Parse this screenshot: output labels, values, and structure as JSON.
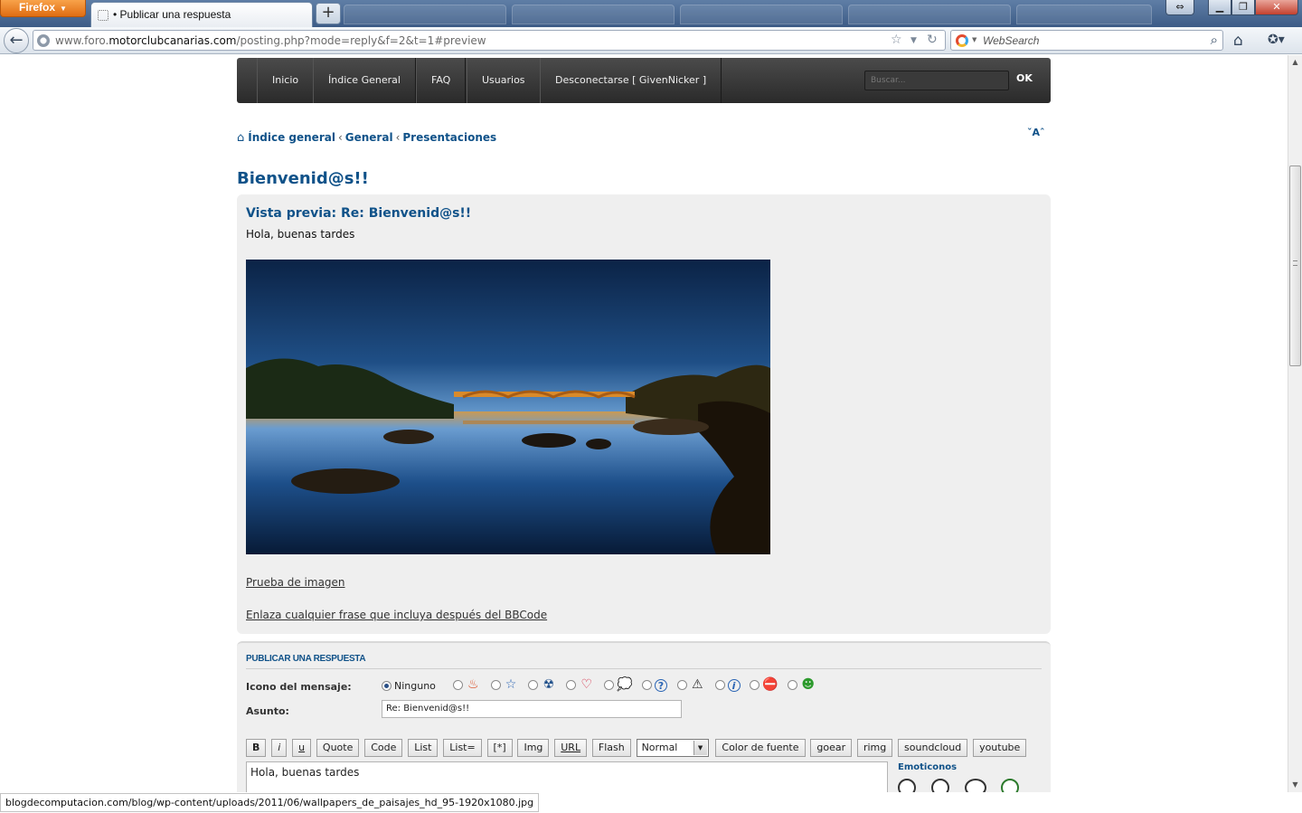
{
  "browser": {
    "app_button": "Firefox",
    "active_tab": "• Publicar una respuesta",
    "new_tab_label": "+",
    "url_prefix": "www.foro.",
    "url_domain": "motorclubcanarias.com",
    "url_path": "/posting.php?mode=reply&f=2&t=1#preview",
    "search_engine_placeholder": "WebSearch",
    "status_url": "blogdecomputacion.com/blog/wp-content/uploads/2011/06/wallpapers_de_paisajes_hd_95-1920x1080.jpg"
  },
  "site_nav": {
    "items": [
      "Inicio",
      "Índice General",
      "FAQ",
      "Usuarios",
      "Desconectarse [ GivenNicker ]"
    ],
    "search_placeholder": "Buscar...",
    "search_button": "OK"
  },
  "breadcrumb": {
    "items": [
      "Índice general",
      "General",
      "Presentaciones"
    ],
    "separator": "‹"
  },
  "font_size_toggle": "ˇAˆ",
  "topic_title": "Bienvenid@s!!",
  "preview": {
    "title": "Vista previa: Re: Bienvenid@s!!",
    "body": "Hola, buenas tardes",
    "link_1": "Prueba de imagen",
    "link_2": "Enlaza cualquier frase que incluya después del BBCode"
  },
  "reply": {
    "heading": "PUBLICAR UNA RESPUESTA",
    "icon_label": "Icono del mensaje:",
    "icon_none": "Ninguno",
    "icons": [
      "flame-icon",
      "star-icon",
      "radioactive-icon",
      "heart-icon",
      "speech-bubble-icon",
      "question-icon",
      "warning-icon",
      "info-icon",
      "no-entry-icon",
      "grin-icon"
    ],
    "subject_label": "Asunto:",
    "subject_value": "Re: Bienvenid@s!!",
    "bbcode_buttons": [
      "B",
      "i",
      "u",
      "Quote",
      "Code",
      "List",
      "List=",
      "[*]",
      "Img",
      "URL",
      "Flash"
    ],
    "font_size_value": "Normal",
    "extra_buttons": [
      "Color de fuente",
      "goear",
      "rimg",
      "soundcloud",
      "youtube"
    ],
    "message_text": "Hola, buenas tardes",
    "smilies_heading": "Emoticonos"
  },
  "colors": {
    "link_blue": "#105289",
    "panel_bg": "#efefef",
    "header_dark": "#333333"
  }
}
